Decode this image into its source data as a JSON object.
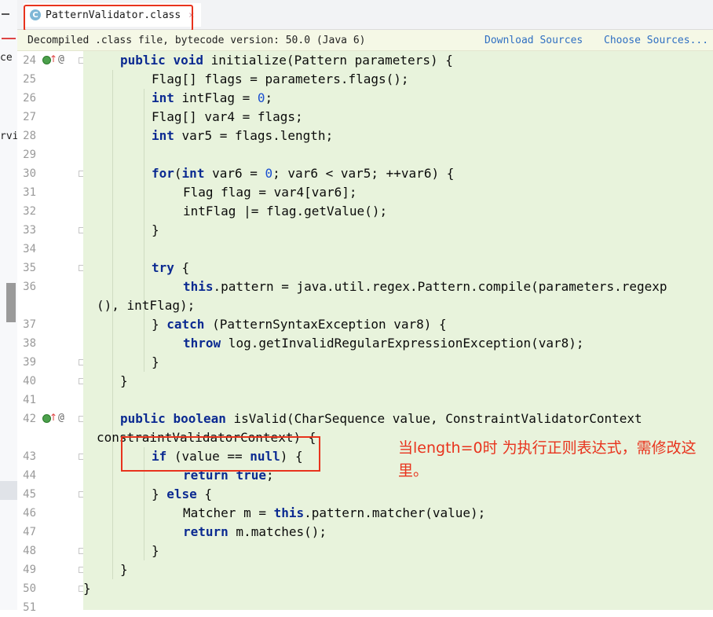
{
  "left_panel": {
    "fragments": [
      "ce",
      "rvi"
    ]
  },
  "tab": {
    "icon_letter": "C",
    "label": "PatternValidator.class",
    "close": "×"
  },
  "banner": {
    "info": "Decompiled .class file, bytecode version: 50.0 (Java 6)",
    "download_sources": "Download Sources",
    "choose_sources": "Choose Sources..."
  },
  "line_numbers": [
    "24",
    "25",
    "26",
    "27",
    "28",
    "29",
    "30",
    "31",
    "32",
    "33",
    "34",
    "35",
    "36",
    "",
    "37",
    "38",
    "39",
    "40",
    "41",
    "42",
    "",
    "43",
    "44",
    "45",
    "46",
    "47",
    "48",
    "49",
    "50",
    "51"
  ],
  "gutter_markers": {
    "override_marker": "↑",
    "annotation_marker": "@"
  },
  "code_lines": [
    {
      "indent": 1,
      "segments": [
        {
          "t": "public",
          "c": "kw"
        },
        {
          "t": " "
        },
        {
          "t": "void",
          "c": "kw"
        },
        {
          "t": " initialize(Pattern parameters) {"
        }
      ]
    },
    {
      "indent": 2,
      "segments": [
        {
          "t": "Flag[] flags = parameters.flags();"
        }
      ]
    },
    {
      "indent": 2,
      "segments": [
        {
          "t": "int",
          "c": "kw"
        },
        {
          "t": " intFlag = "
        },
        {
          "t": "0",
          "c": "num"
        },
        {
          "t": ";"
        }
      ]
    },
    {
      "indent": 2,
      "segments": [
        {
          "t": "Flag[] var4 = flags;"
        }
      ]
    },
    {
      "indent": 2,
      "segments": [
        {
          "t": "int",
          "c": "kw"
        },
        {
          "t": " var5 = flags.length;"
        }
      ]
    },
    {
      "indent": 0,
      "segments": []
    },
    {
      "indent": 2,
      "segments": [
        {
          "t": "for",
          "c": "kw"
        },
        {
          "t": "("
        },
        {
          "t": "int",
          "c": "kw"
        },
        {
          "t": " var6 = "
        },
        {
          "t": "0",
          "c": "num"
        },
        {
          "t": "; var6 < var5; ++var6) {"
        }
      ]
    },
    {
      "indent": 3,
      "segments": [
        {
          "t": "Flag flag = var4[var6];"
        }
      ]
    },
    {
      "indent": 3,
      "segments": [
        {
          "t": "intFlag |= flag.getValue();"
        }
      ]
    },
    {
      "indent": 2,
      "segments": [
        {
          "t": "}"
        }
      ]
    },
    {
      "indent": 0,
      "segments": []
    },
    {
      "indent": 2,
      "segments": [
        {
          "t": "try",
          "c": "kw"
        },
        {
          "t": " {"
        }
      ]
    },
    {
      "indent": 3,
      "segments": [
        {
          "t": "this",
          "c": "kw"
        },
        {
          "t": ".pattern = java.util.regex.Pattern.compile(parameters.regexp"
        }
      ]
    },
    {
      "indent": -1,
      "segments": [
        {
          "t": "(), intFlag);"
        }
      ]
    },
    {
      "indent": 2,
      "segments": [
        {
          "t": "} "
        },
        {
          "t": "catch",
          "c": "kw"
        },
        {
          "t": " (PatternSyntaxException var8) {"
        }
      ]
    },
    {
      "indent": 3,
      "segments": [
        {
          "t": "throw",
          "c": "kw"
        },
        {
          "t": " log.getInvalidRegularExpressionException(var8);"
        }
      ]
    },
    {
      "indent": 2,
      "segments": [
        {
          "t": "}"
        }
      ]
    },
    {
      "indent": 1,
      "segments": [
        {
          "t": "}"
        }
      ]
    },
    {
      "indent": 0,
      "segments": []
    },
    {
      "indent": 1,
      "segments": [
        {
          "t": "public",
          "c": "kw"
        },
        {
          "t": " "
        },
        {
          "t": "boolean",
          "c": "kw"
        },
        {
          "t": " isValid(CharSequence value, ConstraintValidatorContext"
        }
      ]
    },
    {
      "indent": -1,
      "segments": [
        {
          "t": "constraintValidatorContext) {"
        }
      ]
    },
    {
      "indent": 2,
      "segments": [
        {
          "t": "if",
          "c": "kw"
        },
        {
          "t": " (value == "
        },
        {
          "t": "null",
          "c": "kw"
        },
        {
          "t": ") {"
        }
      ]
    },
    {
      "indent": 3,
      "segments": [
        {
          "t": "return",
          "c": "kw"
        },
        {
          "t": " "
        },
        {
          "t": "true",
          "c": "kw"
        },
        {
          "t": ";"
        }
      ]
    },
    {
      "indent": 2,
      "segments": [
        {
          "t": "} "
        },
        {
          "t": "else",
          "c": "kw"
        },
        {
          "t": " {"
        }
      ]
    },
    {
      "indent": 3,
      "segments": [
        {
          "t": "Matcher m = "
        },
        {
          "t": "this",
          "c": "kw"
        },
        {
          "t": ".pattern.matcher(value);"
        }
      ]
    },
    {
      "indent": 3,
      "segments": [
        {
          "t": "return",
          "c": "kw"
        },
        {
          "t": " m.matches();"
        }
      ]
    },
    {
      "indent": 2,
      "segments": [
        {
          "t": "}"
        }
      ]
    },
    {
      "indent": 1,
      "segments": [
        {
          "t": "}"
        }
      ]
    },
    {
      "indent": 0,
      "segments": [
        {
          "t": "}"
        }
      ]
    },
    {
      "indent": 0,
      "segments": []
    }
  ],
  "annotation": {
    "text": "当length=0时 为执行正则表达式，需修改这里。",
    "color": "#e8331d"
  },
  "colors": {
    "code_background": "#e8f3dc",
    "keyword": "#0b2a91",
    "number": "#1a4fd0",
    "link": "#2f6fc2",
    "highlight_box": "#e8331d"
  }
}
